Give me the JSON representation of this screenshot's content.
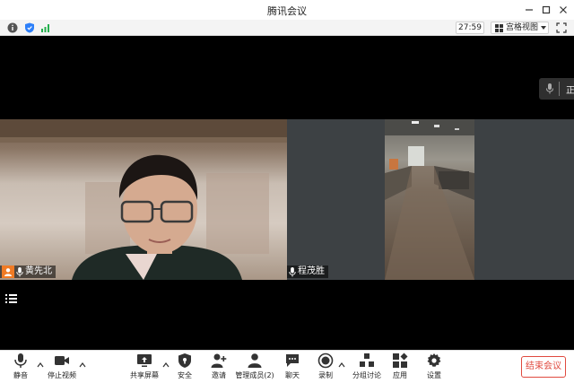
{
  "window": {
    "title": "腾讯会议"
  },
  "toolbar": {
    "timer": "27:59",
    "view_label": "宫格视图"
  },
  "stage": {
    "side_pill_text": "正",
    "participants": [
      {
        "name": "黄先北"
      },
      {
        "name": "程茂胜"
      }
    ]
  },
  "bottombar": {
    "mute": "静音",
    "stop_video": "停止视频",
    "share_screen": "共享屏幕",
    "security": "安全",
    "invite": "邀请",
    "manage_members": "管理成员(2)",
    "chat": "聊天",
    "record": "录制",
    "breakout": "分组讨论",
    "apps": "应用",
    "settings": "设置",
    "end_meeting": "结束会议"
  },
  "colors": {
    "accent_orange": "#f07b25",
    "end_red": "#e04a3f",
    "signal_green": "#23b14d",
    "shield_blue": "#2d7ff9"
  }
}
